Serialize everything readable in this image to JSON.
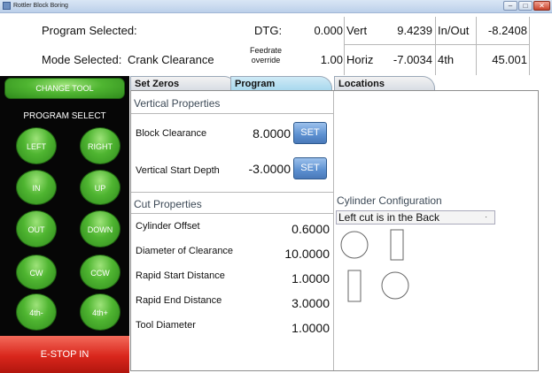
{
  "window": {
    "title": "Rottler Block Boring",
    "minimize": "–",
    "maximize": "□",
    "close": "✕"
  },
  "info": {
    "program_selected_label": "Program Selected:",
    "mode_selected_label": "Mode Selected:",
    "mode_selected_value": "Crank Clearance",
    "dtg_label": "DTG:",
    "dtg_value": "0.000",
    "feedrate_label_line1": "Feedrate",
    "feedrate_label_line2": "override",
    "feedrate_value": "1.00",
    "vert_label": "Vert",
    "vert_value": "9.4239",
    "inout_label": "In/Out",
    "inout_value": "-8.2408",
    "horiz_label": "Horiz",
    "horiz_value": "-7.0034",
    "fourth_label": "4th",
    "fourth_value": "45.001"
  },
  "sidebar": {
    "change_tool": "CHANGE TOOL",
    "program_select": "PROGRAM SELECT",
    "buttons": {
      "left": "LEFT",
      "right": "RIGHT",
      "in": "IN",
      "up": "UP",
      "out": "OUT",
      "down": "DOWN",
      "cw": "CW",
      "ccw": "CCW",
      "fourth_minus": "4th-",
      "fourth_plus": "4th+"
    },
    "estop": "E-STOP IN"
  },
  "tabs": {
    "set_zeros": "Set Zeros",
    "program": "Program",
    "locations": "Locations"
  },
  "vertical_properties": {
    "title": "Vertical Properties",
    "block_clearance_label": "Block Clearance",
    "block_clearance_value": "8.0000",
    "vertical_start_label": "Vertical Start Depth",
    "vertical_start_value": "-3.0000",
    "set_label": "SET"
  },
  "cut_properties": {
    "title": "Cut Properties",
    "rows": [
      {
        "label": "Cylinder Offset",
        "value": "0.6000"
      },
      {
        "label": "Diameter of Clearance",
        "value": "10.0000"
      },
      {
        "label": "Rapid Start Distance",
        "value": "1.0000"
      },
      {
        "label": "Rapid End Distance",
        "value": "3.0000"
      },
      {
        "label": "Tool Diameter",
        "value": "1.0000"
      }
    ]
  },
  "cylinder_config": {
    "title": "Cylinder Configuration",
    "selected": "Left cut is in the Back"
  }
}
